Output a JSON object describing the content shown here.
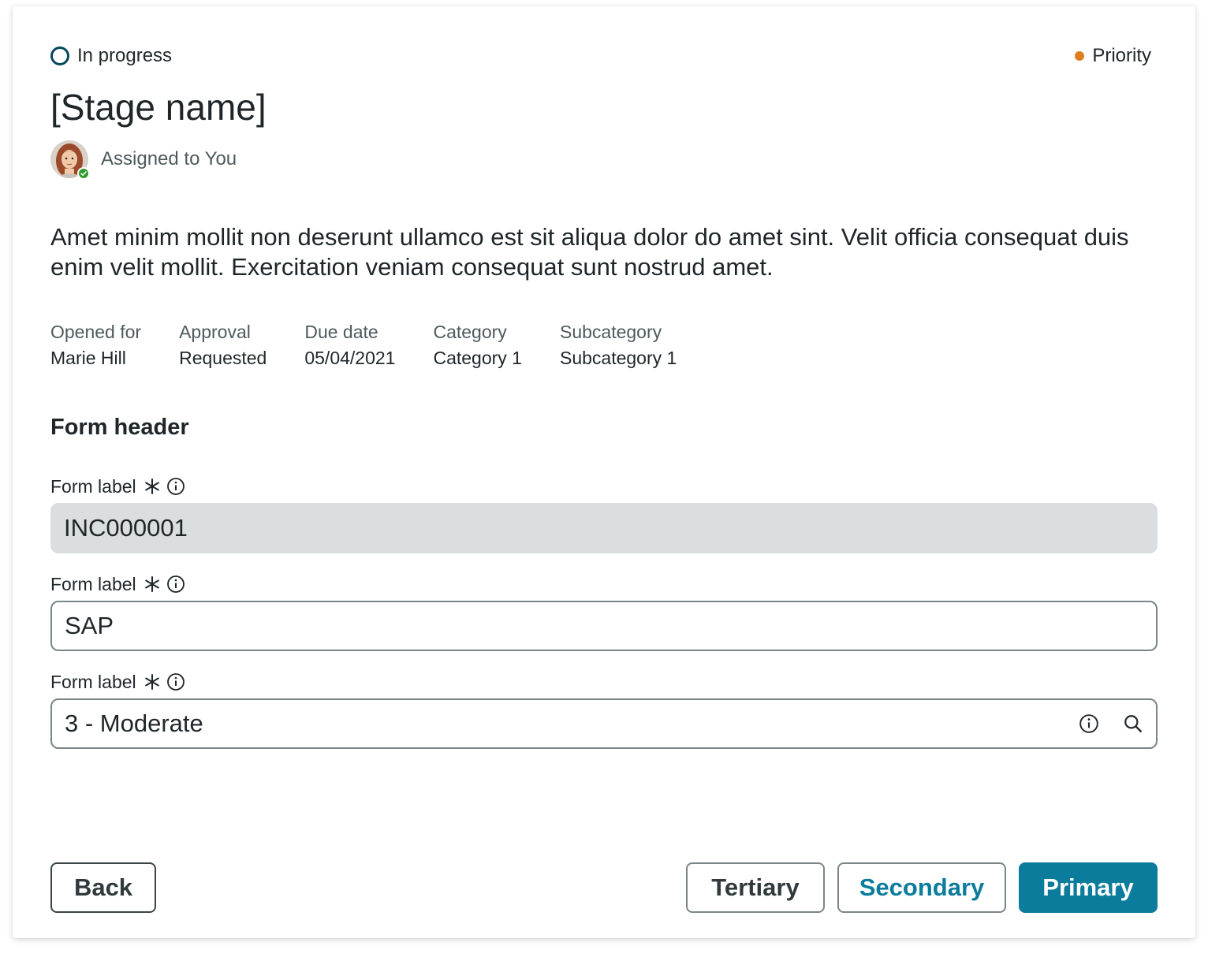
{
  "status": {
    "label": "In progress",
    "ring_color": "#05485a"
  },
  "priority": {
    "label": "Priority",
    "dot_color": "#e07b1f"
  },
  "stage": {
    "title": "[Stage name]"
  },
  "assignee": {
    "text": "Assigned to You",
    "presence": "available"
  },
  "description": "Amet minim mollit non deserunt ullamco est sit aliqua dolor do amet sint. Velit officia consequat duis enim velit mollit. Exercitation veniam consequat sunt nostrud amet.",
  "meta": [
    {
      "label": "Opened for",
      "value": "Marie Hill"
    },
    {
      "label": "Approval",
      "value": "Requested"
    },
    {
      "label": "Due date",
      "value": "05/04/2021"
    },
    {
      "label": "Category",
      "value": "Category 1"
    },
    {
      "label": "Subcategory",
      "value": "Subcategory 1"
    }
  ],
  "form": {
    "header": "Form header",
    "fields": [
      {
        "label": "Form label",
        "value": "INC000001",
        "readonly": true,
        "required": true
      },
      {
        "label": "Form label",
        "value": "SAP",
        "readonly": false,
        "required": true
      },
      {
        "label": "Form label",
        "value": "3 - Moderate",
        "readonly": false,
        "required": true,
        "icons": [
          "info-icon",
          "search-icon"
        ]
      }
    ]
  },
  "buttons": {
    "back": "Back",
    "tertiary": "Tertiary",
    "secondary": "Secondary",
    "primary": "Primary"
  },
  "colors": {
    "primary": "#0b7c9c",
    "text": "#1f2629",
    "muted_text": "#4e5a5e",
    "readonly_bg": "#dbdee1"
  }
}
